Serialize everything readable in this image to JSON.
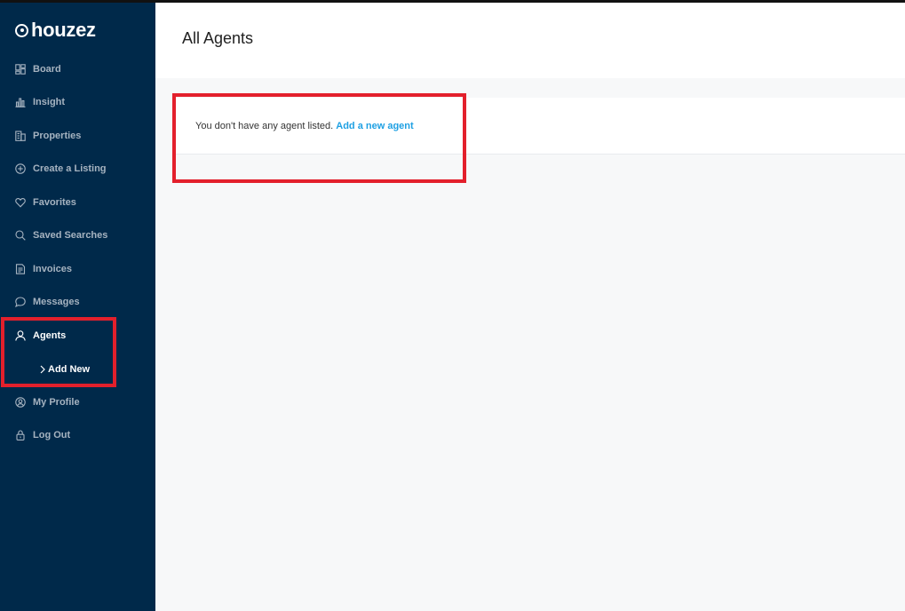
{
  "app": {
    "logo_text": "houzez"
  },
  "sidebar": {
    "items": [
      {
        "label": "Board",
        "icon": "board-icon"
      },
      {
        "label": "Insight",
        "icon": "bar-chart-icon"
      },
      {
        "label": "Properties",
        "icon": "building-icon"
      },
      {
        "label": "Create a Listing",
        "icon": "plus-circle-icon"
      },
      {
        "label": "Favorites",
        "icon": "heart-icon"
      },
      {
        "label": "Saved Searches",
        "icon": "search-icon"
      },
      {
        "label": "Invoices",
        "icon": "invoice-icon"
      },
      {
        "label": "Messages",
        "icon": "chat-icon"
      },
      {
        "label": "Agents",
        "icon": "user-icon",
        "active": true
      },
      {
        "label": "My Profile",
        "icon": "profile-icon"
      },
      {
        "label": "Log Out",
        "icon": "lock-icon"
      }
    ],
    "agents_sub": {
      "label": "Add New"
    }
  },
  "main": {
    "title": "All Agents",
    "empty_message": "You don't have any agent listed.",
    "empty_link": "Add a new agent"
  },
  "colors": {
    "sidebar_bg": "#00294a",
    "sidebar_text": "#a6b3c0",
    "link": "#1ea0e3",
    "highlight": "#e3202c"
  }
}
